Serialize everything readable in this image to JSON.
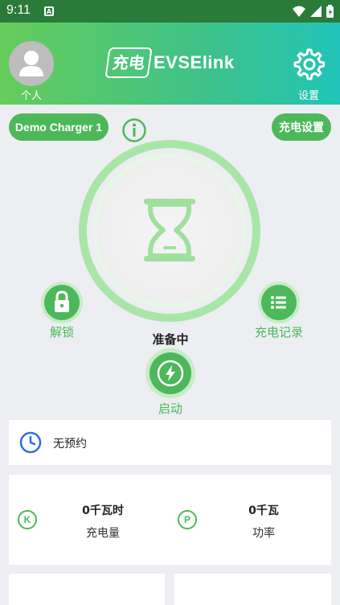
{
  "status_bar": {
    "time": "9:11",
    "app_badge": "A"
  },
  "header": {
    "avatar_label": "个人",
    "logo_badge": "充电",
    "logo_text": "EVSElink",
    "settings_label": "设置"
  },
  "charger": {
    "name": "Demo Charger 1",
    "settings_button": "充电设置"
  },
  "controls": {
    "unlock_label": "解锁",
    "records_label": "充电记录",
    "status": "准备中",
    "start_label": "启动"
  },
  "schedule": {
    "text": "无预约"
  },
  "stats": {
    "energy": {
      "icon_letter": "K",
      "value": "0千瓦时",
      "label": "充电量"
    },
    "power": {
      "icon_letter": "P",
      "value": "0千瓦",
      "label": "功率"
    }
  },
  "colors": {
    "accent": "#4cb85a",
    "ring": "#a8e6a8",
    "background": "#eceef2"
  }
}
